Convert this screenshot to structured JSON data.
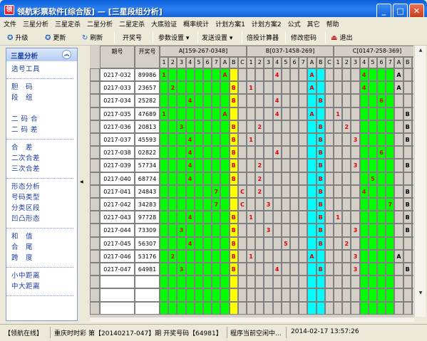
{
  "window": {
    "title": "领航彩票软件[综合版] — [三星段组分析]",
    "app_icon": "app-logo-icon",
    "buttons": [
      "_",
      "□",
      "✕"
    ]
  },
  "menu": [
    "文件",
    "三星分析",
    "三星定杀",
    "二星分析",
    "二星定杀",
    "大底验证",
    "概率统计",
    "计划方案1",
    "计划方案2",
    "公式",
    "其它",
    "帮助"
  ],
  "toolbar": {
    "upgrade": "升级",
    "update": "更新",
    "refresh": "刷新",
    "lottery_number": "开奖号",
    "param_settings": "参数设置 ▾",
    "send_settings": "发送设置 ▾",
    "multiple_calc": "倍投计算器",
    "change_password": "修改密码",
    "exit": "退出"
  },
  "sidebar": {
    "header": "三星分析",
    "groups": [
      [
        "选号工具"
      ],
      [
        "胆　码",
        "段　组",
        "",
        "二 码 合",
        "二 码 差"
      ],
      [
        "合　差",
        "二次合差",
        "三次合差"
      ],
      [
        "形态分析",
        "号码类型",
        "分类区段",
        "凹凸形态"
      ],
      [
        "和　值",
        "合　尾",
        "跨　度"
      ],
      [
        "小中距离",
        "中大距离"
      ]
    ]
  },
  "grid": {
    "headers": {
      "period": "期号",
      "number": "开奖号",
      "group_a": "A[159-267-0348]",
      "group_b": "B[037-1458-269]",
      "group_c": "C[0147-258-369]"
    },
    "group_a_cols": [
      "1",
      "2",
      "3",
      "4",
      "5",
      "6",
      "7",
      "A",
      "B",
      "C"
    ],
    "group_b_cols": [
      "1",
      "2",
      "3",
      "4",
      "5",
      "6",
      "7",
      "A",
      "B",
      "C"
    ],
    "group_c_cols": [
      "1",
      "2",
      "3",
      "4",
      "5",
      "6",
      "7",
      "A",
      "B",
      "C"
    ],
    "rows": [
      {
        "period": "0217-032",
        "number": "89986",
        "a": {
          "1": "1",
          "A": "A"
        },
        "b": {
          "4": "4",
          "A": "A"
        },
        "c": {
          "4": "4",
          "A": "A"
        }
      },
      {
        "period": "0217-033",
        "number": "23657",
        "a": {
          "2": "2",
          "B": "B"
        },
        "b": {
          "1": "1",
          "A": "A"
        },
        "c": {
          "4": "4",
          "A": "A"
        }
      },
      {
        "period": "0217-034",
        "number": "25282",
        "a": {
          "4": "4",
          "B": "B"
        },
        "b": {
          "4": "4",
          "B": "B"
        },
        "c": {
          "6": "6",
          "C": "C"
        }
      },
      {
        "period": "0217-035",
        "number": "47689",
        "a": {
          "1": "1",
          "A": "A"
        },
        "b": {
          "4": "4",
          "A": "A"
        },
        "c": {
          "1": "1",
          "B": "B"
        }
      },
      {
        "period": "0217-036",
        "number": "20813",
        "a": {
          "3": "3",
          "B": "B"
        },
        "b": {
          "2": "2",
          "B": "B"
        },
        "c": {
          "2": "2",
          "B": "B"
        }
      },
      {
        "period": "0217-037",
        "number": "45593",
        "a": {
          "4": "4",
          "B": "B"
        },
        "b": {
          "1": "1",
          "B": "B"
        },
        "c": {
          "3": "3",
          "B": "B"
        }
      },
      {
        "period": "0217-038",
        "number": "02822",
        "a": {
          "4": "4",
          "B": "B"
        },
        "b": {
          "4": "4",
          "B": "B"
        },
        "c": {
          "6": "6",
          "C": "C"
        }
      },
      {
        "period": "0217-039",
        "number": "57734",
        "a": {
          "4": "4",
          "B": "B"
        },
        "b": {
          "2": "2",
          "B": "B"
        },
        "c": {
          "3": "3",
          "B": "B"
        }
      },
      {
        "period": "0217-040",
        "number": "68774",
        "a": {
          "4": "4",
          "B": "B"
        },
        "b": {
          "2": "2",
          "B": "B"
        },
        "c": {
          "5": "5",
          "C": "C"
        }
      },
      {
        "period": "0217-041",
        "number": "24843",
        "a": {
          "7": "7",
          "C": "C"
        },
        "b": {
          "2": "2",
          "B": "B"
        },
        "c": {
          "4": "4",
          "B": "B"
        }
      },
      {
        "period": "0217-042",
        "number": "34283",
        "a": {
          "7": "7",
          "C": "C"
        },
        "b": {
          "3": "3",
          "B": "B"
        },
        "c": {
          "7": "7",
          "B": "B"
        }
      },
      {
        "period": "0217-043",
        "number": "97728",
        "a": {
          "4": "4",
          "B": "B"
        },
        "b": {
          "1": "1",
          "B": "B"
        },
        "c": {
          "1": "1",
          "B": "B"
        }
      },
      {
        "period": "0217-044",
        "number": "73309",
        "a": {
          "3": "3",
          "B": "B"
        },
        "b": {
          "3": "3",
          "B": "B"
        },
        "c": {
          "3": "3",
          "B": "B"
        }
      },
      {
        "period": "0217-045",
        "number": "56307",
        "a": {
          "4": "4",
          "B": "B"
        },
        "b": {
          "5": "5",
          "B": "B"
        },
        "c": {
          "2": "2",
          "C": "C"
        }
      },
      {
        "period": "0217-046",
        "number": "53176",
        "a": {
          "2": "2",
          "B": "B"
        },
        "b": {
          "1": "1",
          "A": "A"
        },
        "c": {
          "3": "3",
          "A": "A"
        }
      },
      {
        "period": "0217-047",
        "number": "64981",
        "a": {
          "3": "3",
          "B": "B"
        },
        "b": {
          "4": "4",
          "B": "B"
        },
        "c": {
          "3": "3",
          "B": "B"
        }
      }
    ],
    "empty_rows": 3
  },
  "status": {
    "online": "【领航在线】",
    "lottery": "重庆时时彩",
    "draw_info": "第【20140217-047】期 开奖号码【64981】",
    "program_state": "程序当前空闲中...",
    "datetime": "2014-02-17 13:57:26"
  },
  "colors": {
    "green": "#00ff00",
    "yellow": "#ffff00",
    "cyan": "#00ffff",
    "grey": "#d4d0c8",
    "hit_text": "#e00000",
    "c_hit_text": "#000000",
    "grid_line": "#808080",
    "sidebar_text": "#1a3c9c"
  }
}
